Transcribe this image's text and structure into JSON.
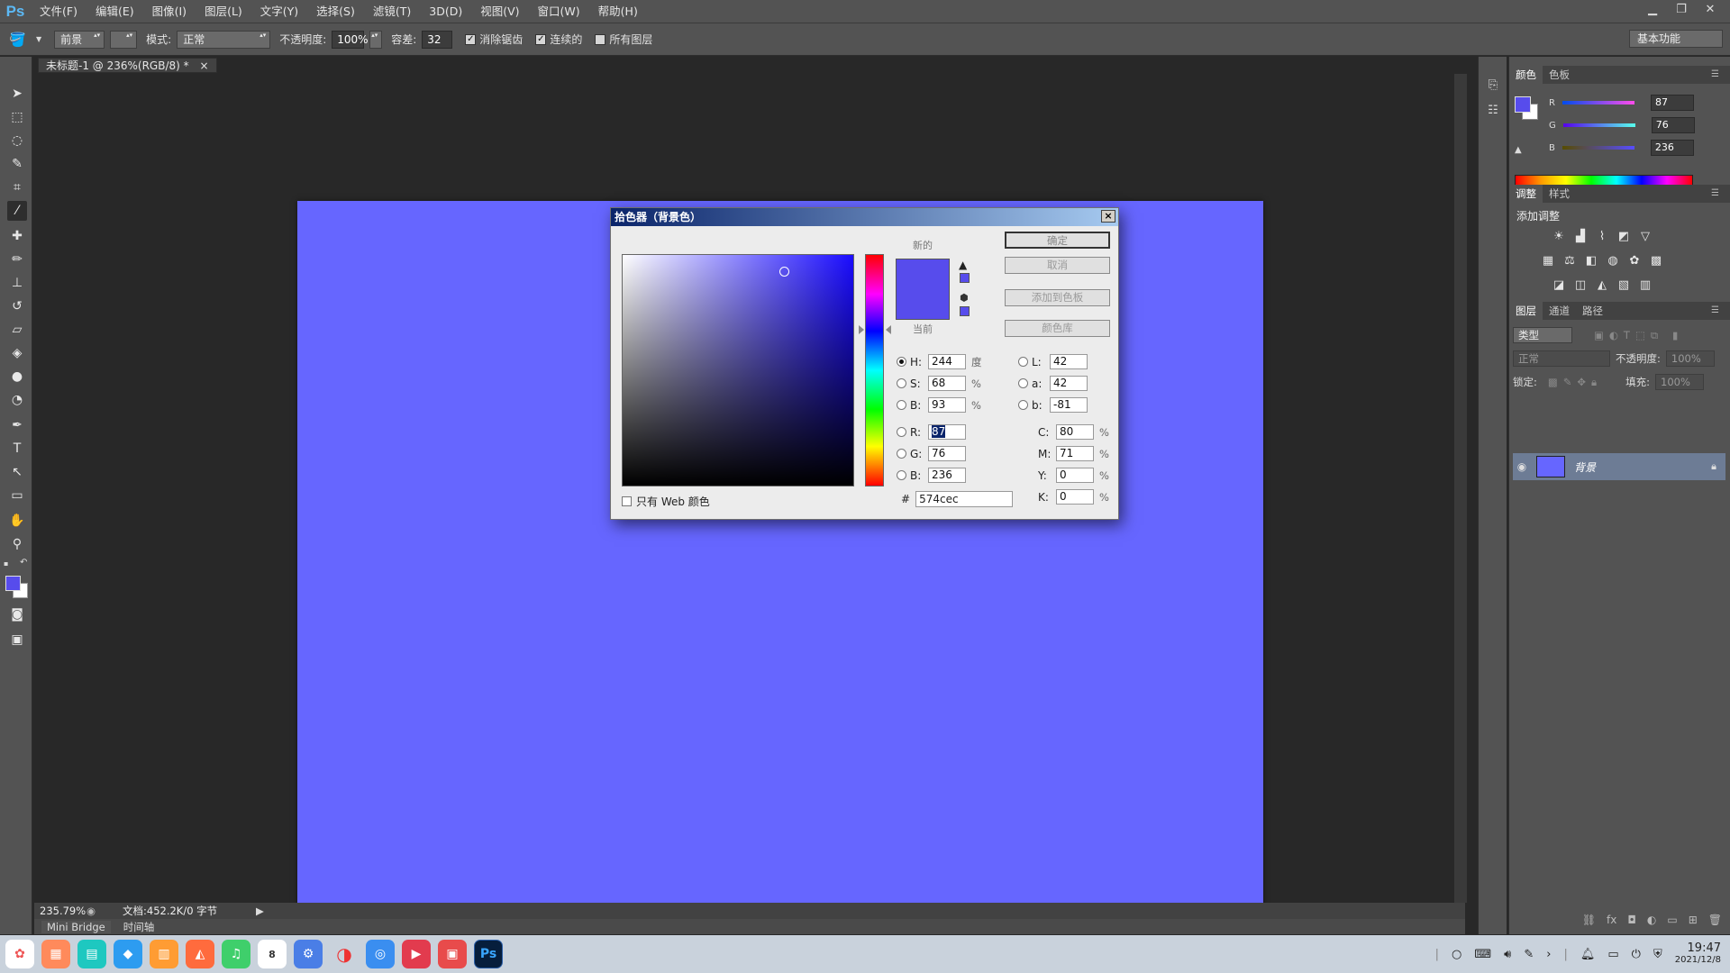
{
  "app": {
    "logo": "Ps"
  },
  "menu": [
    "文件(F)",
    "编辑(E)",
    "图像(I)",
    "图层(L)",
    "文字(Y)",
    "选择(S)",
    "滤镜(T)",
    "3D(D)",
    "视图(V)",
    "窗口(W)",
    "帮助(H)"
  ],
  "options": {
    "source": "前景",
    "mode_label": "模式:",
    "mode_value": "正常",
    "opacity_label": "不透明度:",
    "opacity_value": "100%",
    "tolerance_label": "容差:",
    "tolerance_value": "32",
    "antialias": "消除锯齿",
    "contiguous": "连续的",
    "all_layers": "所有图层",
    "workspace": "基本功能"
  },
  "document": {
    "tab_title": "未标题-1 @ 236%(RGB/8) *",
    "tab_close": "×",
    "canvas_color": "#6666ff",
    "zoom": "235.79%",
    "doc_size": "文档:452.2K/0 字节",
    "bottom_tabs": [
      "Mini Bridge",
      "时间轴"
    ]
  },
  "dialog": {
    "title": "拾色器（背景色）",
    "close": "×",
    "new_label": "新的",
    "current_label": "当前",
    "buttons": {
      "ok": "确定",
      "cancel": "取消",
      "add_swatch": "添加到色板",
      "libraries": "颜色库"
    },
    "web_only": "只有 Web 颜色",
    "fields": {
      "H": {
        "label": "H:",
        "value": "244",
        "unit": "度"
      },
      "S": {
        "label": "S:",
        "value": "68",
        "unit": "%"
      },
      "Bv": {
        "label": "B:",
        "value": "93",
        "unit": "%"
      },
      "R": {
        "label": "R:",
        "value": "87"
      },
      "G": {
        "label": "G:",
        "value": "76"
      },
      "Bc": {
        "label": "B:",
        "value": "236"
      },
      "L": {
        "label": "L:",
        "value": "42"
      },
      "a": {
        "label": "a:",
        "value": "42"
      },
      "b": {
        "label": "b:",
        "value": "-81"
      },
      "C": {
        "label": "C:",
        "value": "80",
        "unit": "%"
      },
      "M": {
        "label": "M:",
        "value": "71",
        "unit": "%"
      },
      "Y": {
        "label": "Y:",
        "value": "0",
        "unit": "%"
      },
      "K": {
        "label": "K:",
        "value": "0",
        "unit": "%"
      }
    },
    "hex_label": "#",
    "hex": "574cec",
    "new_color": "#574cec"
  },
  "color_panel": {
    "tabs": [
      "颜色",
      "色板"
    ],
    "R": {
      "label": "R",
      "value": "87"
    },
    "G": {
      "label": "G",
      "value": "76"
    },
    "B": {
      "label": "B",
      "value": "236"
    }
  },
  "adjust_panel": {
    "tabs": [
      "调整",
      "样式"
    ],
    "title": "添加调整"
  },
  "layers_panel": {
    "tabs": [
      "图层",
      "通道",
      "路径"
    ],
    "kind": "类型",
    "blend": "正常",
    "opacity_label": "不透明度:",
    "opacity_value": "100%",
    "lock_label": "锁定:",
    "fill_label": "填充:",
    "fill_value": "100%",
    "layer_name": "背景"
  },
  "taskbar": {
    "time": "19:47",
    "date": "2021/12/8",
    "ps_label": "Ps",
    "calendar_day": "8"
  }
}
